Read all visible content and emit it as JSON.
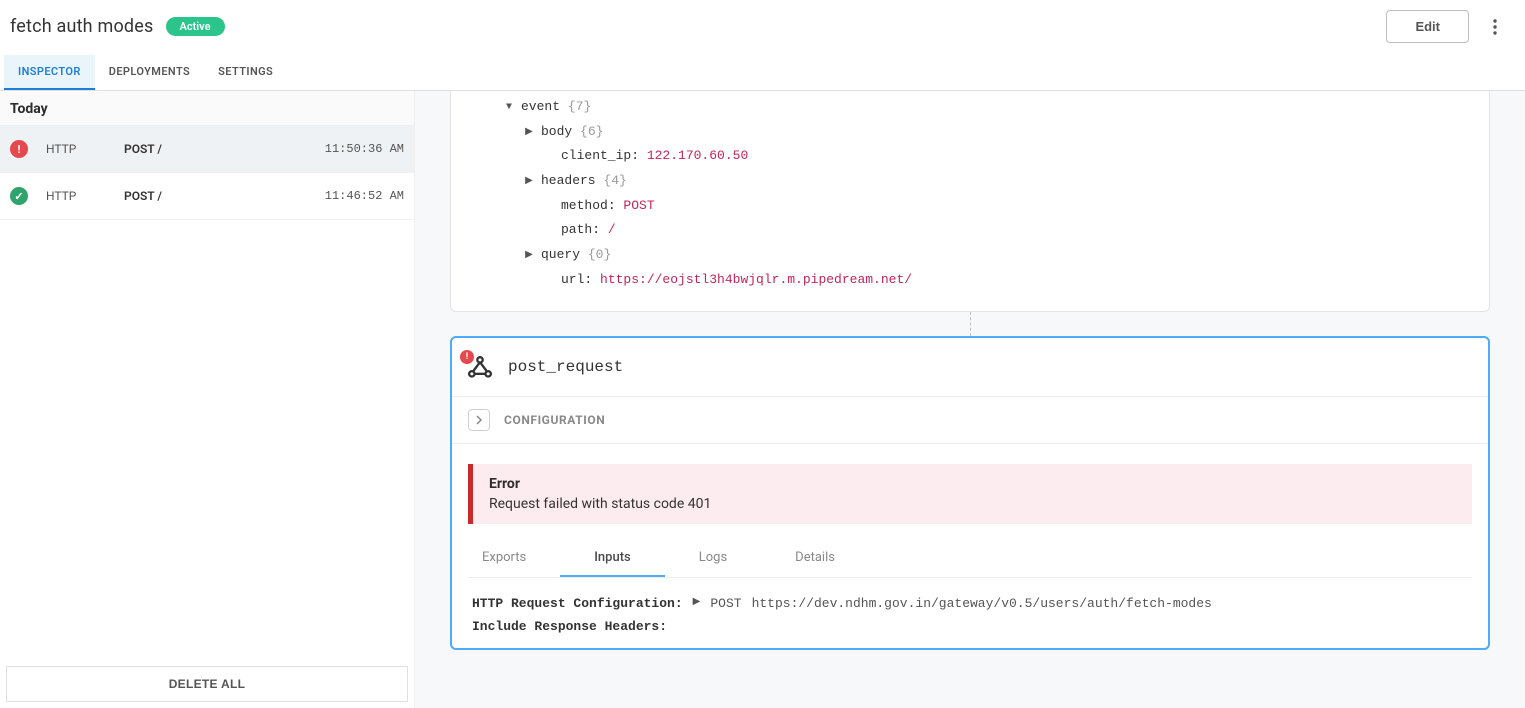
{
  "header": {
    "title": "fetch auth modes",
    "status": "Active",
    "edit": "Edit"
  },
  "nav": {
    "tabs": [
      "INSPECTOR",
      "DEPLOYMENTS",
      "SETTINGS"
    ],
    "active": 0
  },
  "sidebar": {
    "date_label": "Today",
    "events": [
      {
        "status": "error",
        "proto": "HTTP",
        "method_path": "POST /",
        "time": "11:50:36 AM"
      },
      {
        "status": "success",
        "proto": "HTTP",
        "method_path": "POST /",
        "time": "11:46:52 AM"
      }
    ],
    "delete_all": "DELETE ALL"
  },
  "event_tree": {
    "root": {
      "key": "event",
      "count": 7
    },
    "children": [
      {
        "key": "body",
        "kind": "obj",
        "count": 6
      },
      {
        "key": "client_ip",
        "kind": "kv",
        "value": "122.170.60.50"
      },
      {
        "key": "headers",
        "kind": "obj",
        "count": 4
      },
      {
        "key": "method",
        "kind": "kv",
        "value": "POST"
      },
      {
        "key": "path",
        "kind": "kv",
        "value": "/"
      },
      {
        "key": "query",
        "kind": "obj",
        "count": 0
      },
      {
        "key": "url",
        "kind": "kv",
        "value": "https://eojstl3h4bwjqlr.m.pipedream.net/"
      }
    ]
  },
  "step": {
    "name": "post_request",
    "config_label": "CONFIGURATION",
    "error": {
      "title": "Error",
      "message": "Request failed with status code 401"
    },
    "subtabs": [
      "Exports",
      "Inputs",
      "Logs",
      "Details"
    ],
    "subtab_active": 1,
    "inputs": {
      "rows": [
        {
          "label": "HTTP Request Configuration:",
          "expandable": true,
          "method": "POST",
          "url": "https://dev.ndhm.gov.in/gateway/v0.5/users/auth/fetch-modes"
        },
        {
          "label": "Include Response Headers:",
          "expandable": false
        }
      ]
    }
  }
}
